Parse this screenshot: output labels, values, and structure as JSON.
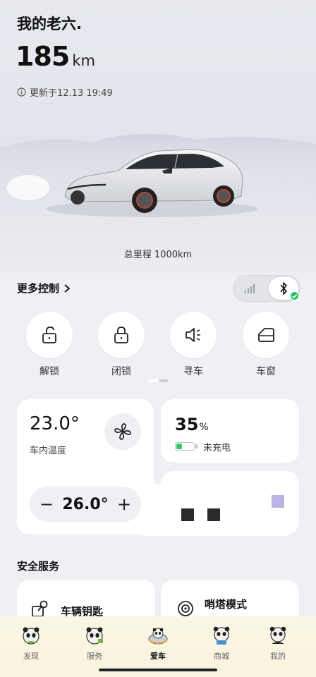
{
  "header": {
    "car_name": "我的老六.",
    "range_value": "185",
    "range_unit": "km",
    "updated": "更新于12.13 19:49",
    "odometer": "总里程 1000km"
  },
  "more_controls": {
    "label": "更多控制",
    "connection": {
      "active": "bluetooth",
      "connected": true
    }
  },
  "quick_controls": [
    {
      "label": "解锁",
      "icon": "unlock-icon"
    },
    {
      "label": "闭锁",
      "icon": "lock-icon"
    },
    {
      "label": "寻车",
      "icon": "horn-icon"
    },
    {
      "label": "车窗",
      "icon": "window-icon"
    }
  ],
  "pager": {
    "page": 1,
    "pages": 2
  },
  "climate": {
    "interior_temp": "23.0°",
    "interior_label": "车内温度",
    "setpoint": "26.0°",
    "minus": "−",
    "plus": "+"
  },
  "battery": {
    "percent": "35",
    "percent_symbol": "%",
    "level": 0.35,
    "status": "未充电",
    "color": "#37c86a"
  },
  "safety": {
    "title": "安全服务",
    "items": [
      {
        "label": "车辆钥匙",
        "icon": "key-icon"
      },
      {
        "label": "哨塔模式",
        "icon": "sentry-icon"
      }
    ]
  },
  "nav": {
    "tabs": [
      {
        "label": "发现",
        "active": false
      },
      {
        "label": "服务",
        "active": false
      },
      {
        "label": "爱车",
        "active": true
      },
      {
        "label": "商城",
        "active": false
      },
      {
        "label": "我的",
        "active": false
      }
    ]
  }
}
